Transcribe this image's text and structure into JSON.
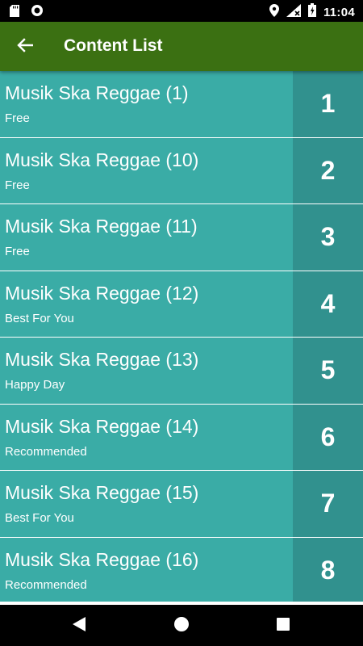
{
  "status_bar": {
    "time": "11:04",
    "left_icons": [
      "sd-card-icon",
      "circle-notification-icon"
    ],
    "right_icons": [
      "location-icon",
      "wifi-icon",
      "battery-icon"
    ]
  },
  "app_bar": {
    "title": "Content List",
    "back_icon": "arrow-back-icon",
    "color": "#3b7012"
  },
  "colors": {
    "item_bg": "#3aaca6",
    "number_bg": "#31918e"
  },
  "items": [
    {
      "title": "Musik Ska Reggae (1)",
      "subtitle": "Free",
      "number": "1"
    },
    {
      "title": "Musik Ska Reggae (10)",
      "subtitle": "Free",
      "number": "2"
    },
    {
      "title": "Musik Ska Reggae (11)",
      "subtitle": "Free",
      "number": "3"
    },
    {
      "title": "Musik Ska Reggae (12)",
      "subtitle": "Best For You",
      "number": "4"
    },
    {
      "title": "Musik Ska Reggae (13)",
      "subtitle": "Happy Day",
      "number": "5"
    },
    {
      "title": "Musik Ska Reggae (14)",
      "subtitle": "Recommended",
      "number": "6"
    },
    {
      "title": "Musik Ska Reggae (15)",
      "subtitle": "Best For You",
      "number": "7"
    },
    {
      "title": "Musik Ska Reggae (16)",
      "subtitle": "Recommended",
      "number": "8"
    }
  ],
  "nav_bar": {
    "icons": [
      "back-triangle-icon",
      "home-circle-icon",
      "recents-square-icon"
    ]
  }
}
